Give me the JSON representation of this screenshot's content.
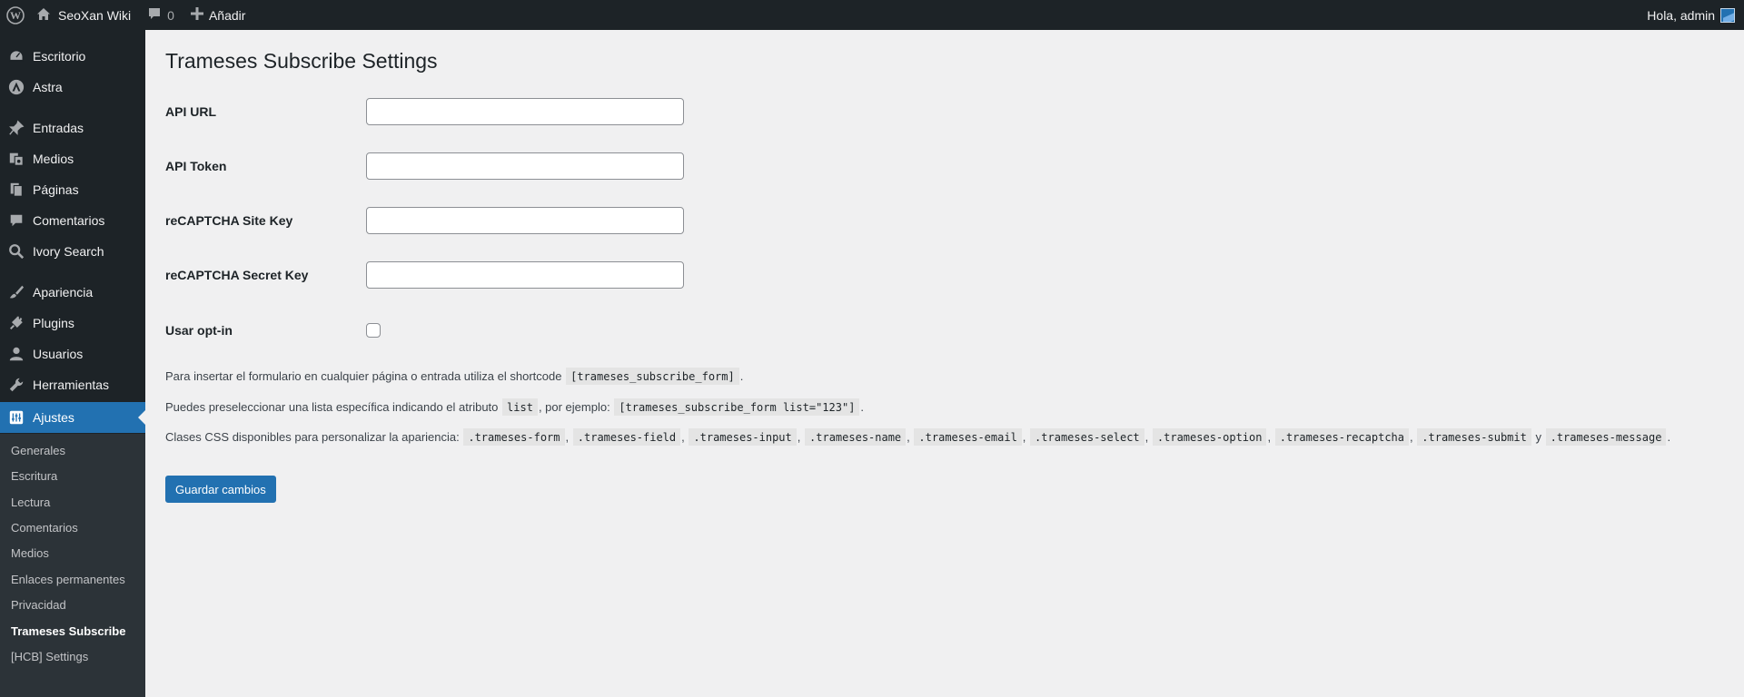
{
  "adminbar": {
    "site_name": "SeoXan Wiki",
    "comments_count": "0",
    "new_label": "Añadir",
    "greeting": "Hola, admin"
  },
  "sidebar": {
    "items": [
      {
        "label": "Escritorio",
        "icon": "dashboard-icon"
      },
      {
        "label": "Astra",
        "icon": "astra-icon"
      },
      {
        "label": "Entradas",
        "icon": "pin-icon"
      },
      {
        "label": "Medios",
        "icon": "media-icon"
      },
      {
        "label": "Páginas",
        "icon": "pages-icon"
      },
      {
        "label": "Comentarios",
        "icon": "comments-icon"
      },
      {
        "label": "Ivory Search",
        "icon": "search-icon"
      },
      {
        "label": "Apariencia",
        "icon": "brush-icon"
      },
      {
        "label": "Plugins",
        "icon": "plug-icon"
      },
      {
        "label": "Usuarios",
        "icon": "user-icon"
      },
      {
        "label": "Herramientas",
        "icon": "wrench-icon"
      },
      {
        "label": "Ajustes",
        "icon": "settings-icon"
      }
    ],
    "submenu": [
      "Generales",
      "Escritura",
      "Lectura",
      "Comentarios",
      "Medios",
      "Enlaces permanentes",
      "Privacidad",
      "Trameses Subscribe",
      "[HCB] Settings"
    ]
  },
  "page": {
    "title": "Trameses Subscribe Settings",
    "fields": [
      {
        "label": "API URL",
        "value": ""
      },
      {
        "label": "API Token",
        "value": ""
      },
      {
        "label": "reCAPTCHA Site Key",
        "value": ""
      },
      {
        "label": "reCAPTCHA Secret Key",
        "value": ""
      }
    ],
    "optin_label": "Usar opt-in",
    "help1": {
      "text": "Para insertar el formulario en cualquier página o entrada utiliza el shortcode",
      "code": "[trameses_subscribe_form]",
      "end": "."
    },
    "help2": {
      "text1": "Puedes preseleccionar una lista específica indicando el atributo",
      "code1": "list",
      "text2": ", por ejemplo:",
      "code2": "[trameses_subscribe_form list=\"123\"]",
      "end": "."
    },
    "help3": {
      "text": "Clases CSS disponibles para personalizar la apariencia:",
      "classes": [
        ".trameses-form",
        ".trameses-field",
        ".trameses-input",
        ".trameses-name",
        ".trameses-email",
        ".trameses-select",
        ".trameses-option",
        ".trameses-recaptcha",
        ".trameses-submit"
      ],
      "and": "y",
      "last": ".trameses-message",
      "comma": ",",
      "end": "."
    },
    "save_label": "Guardar cambios"
  },
  "colors": {
    "adminbar_bg": "#1d2327",
    "accent": "#2271b1",
    "content_bg": "#f0f0f1"
  }
}
